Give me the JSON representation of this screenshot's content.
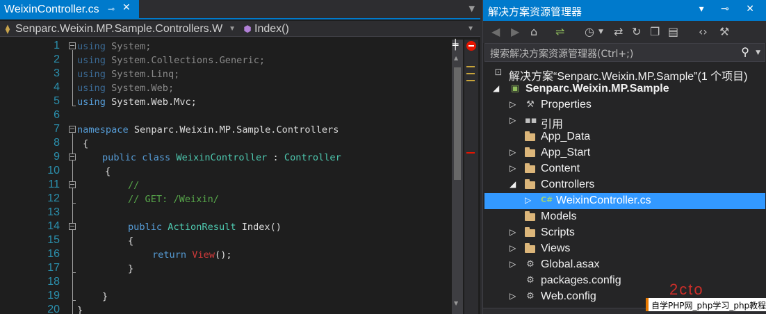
{
  "editor": {
    "tab_title": "WeixinController.cs",
    "tab_pin": "⊸",
    "tab_close": "✕",
    "nav_class": "Senparc.Weixin.MP.Sample.Controllers.W",
    "nav_method": "Index()",
    "line_numbers": [
      "1",
      "2",
      "3",
      "4",
      "5",
      "6",
      "7",
      "8",
      "9",
      "10",
      "11",
      "12",
      "13",
      "14",
      "15",
      "16",
      "17",
      "18",
      "19",
      "20"
    ],
    "lines": {
      "l1": "using",
      "l1b": " System;",
      "l2": "using",
      "l2b": " System.Collections.Generic;",
      "l3": "using",
      "l3b": " System.Linq;",
      "l4": "using",
      "l4b": " System.Web;",
      "l5": "using",
      "l5b": " System.Web.Mvc;",
      "l7": "namespace",
      "l7b": " Senparc.Weixin.MP.Sample.Controllers",
      "l8": " {",
      "l9a": "public",
      "l9b": "class",
      "l9c": "WeixinController",
      "l9d": " : ",
      "l9e": "Controller",
      "l10": "{",
      "l11": "//",
      "l12": "// GET: /Weixin/",
      "l14a": "public",
      "l14b": "ActionResult",
      "l14c": " Index()",
      "l15": "{",
      "l16a": "return",
      "l16b": "View",
      "l16c": "();",
      "l17": "}",
      "l19": "}",
      "l20": "}"
    }
  },
  "solution_explorer": {
    "title": "解决方案资源管理器",
    "title_buttons": "▾ ⊸ ✕",
    "search_placeholder": "搜索解决方案资源管理器(Ctrl+;)",
    "tree": [
      {
        "label": "解决方案“Senparc.Weixin.MP.Sample”(1 个项目)"
      },
      {
        "label": "Senparc.Weixin.MP.Sample"
      },
      {
        "label": "Properties"
      },
      {
        "label": "引用"
      },
      {
        "label": "App_Data"
      },
      {
        "label": "App_Start"
      },
      {
        "label": "Content"
      },
      {
        "label": "Controllers"
      },
      {
        "label": "WeixinController.cs"
      },
      {
        "label": "Models"
      },
      {
        "label": "Scripts"
      },
      {
        "label": "Views"
      },
      {
        "label": "Global.asax"
      },
      {
        "label": "packages.config"
      },
      {
        "label": "Web.config"
      }
    ]
  },
  "watermark": {
    "logo": "2cto",
    "text": "自学PHP网_php学习_php教程"
  },
  "colors": {
    "accent": "#007acc",
    "selection": "#3399ff",
    "keyword": "#569cd6",
    "type": "#4ec9b0",
    "comment": "#57a64a",
    "line_number": "#2b91af"
  }
}
